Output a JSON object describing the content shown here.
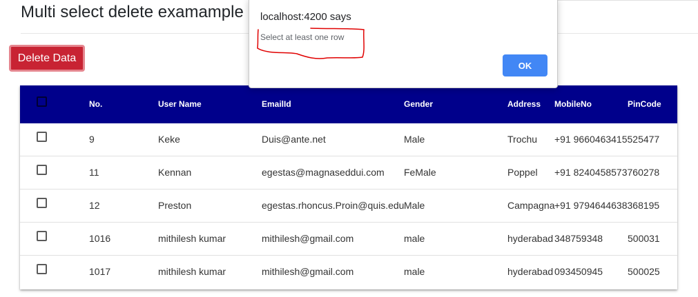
{
  "page": {
    "title": "Multi select delete examample",
    "delete_button": "Delete Data"
  },
  "dialog": {
    "title": "localhost:4200 says",
    "message": "Select at least one row",
    "ok_label": "OK"
  },
  "table": {
    "headers": {
      "no": "No.",
      "user": "User Name",
      "email": "EmailId",
      "gender": "Gender",
      "address": "Address",
      "mobile": "MobileNo",
      "pin": "PinCode"
    },
    "rows": [
      {
        "no": "9",
        "user": "Keke",
        "email": "Duis@ante.net",
        "gender": "Male",
        "address": "Trochu",
        "mobile": "+91 9660463415525477",
        "pin": ""
      },
      {
        "no": "11",
        "user": "Kennan",
        "email": "egestas@magnaseddui.com",
        "gender": "FeMale",
        "address": "Poppel",
        "mobile": "+91 8240458573760278",
        "pin": ""
      },
      {
        "no": "12",
        "user": "Preston",
        "email": "egestas.rhoncus.Proin@quis.edu",
        "gender": "Male",
        "address": "Campagna",
        "mobile": "+91 9794644638368195",
        "pin": ""
      },
      {
        "no": "1016",
        "user": "mithilesh kumar",
        "email": "mithilesh@gmail.com",
        "gender": "male",
        "address": "hyderabad",
        "mobile": "348759348",
        "pin": "500031"
      },
      {
        "no": "1017",
        "user": "mithilesh kumar",
        "email": "mithilesh@gmail.com",
        "gender": "male",
        "address": "hyderabad",
        "mobile": "093450945",
        "pin": "500025"
      }
    ]
  },
  "colors": {
    "header_bg": "#00008b",
    "delete_button": "#c82333",
    "ok_button": "#4287f5",
    "annotation": "#e00000"
  }
}
